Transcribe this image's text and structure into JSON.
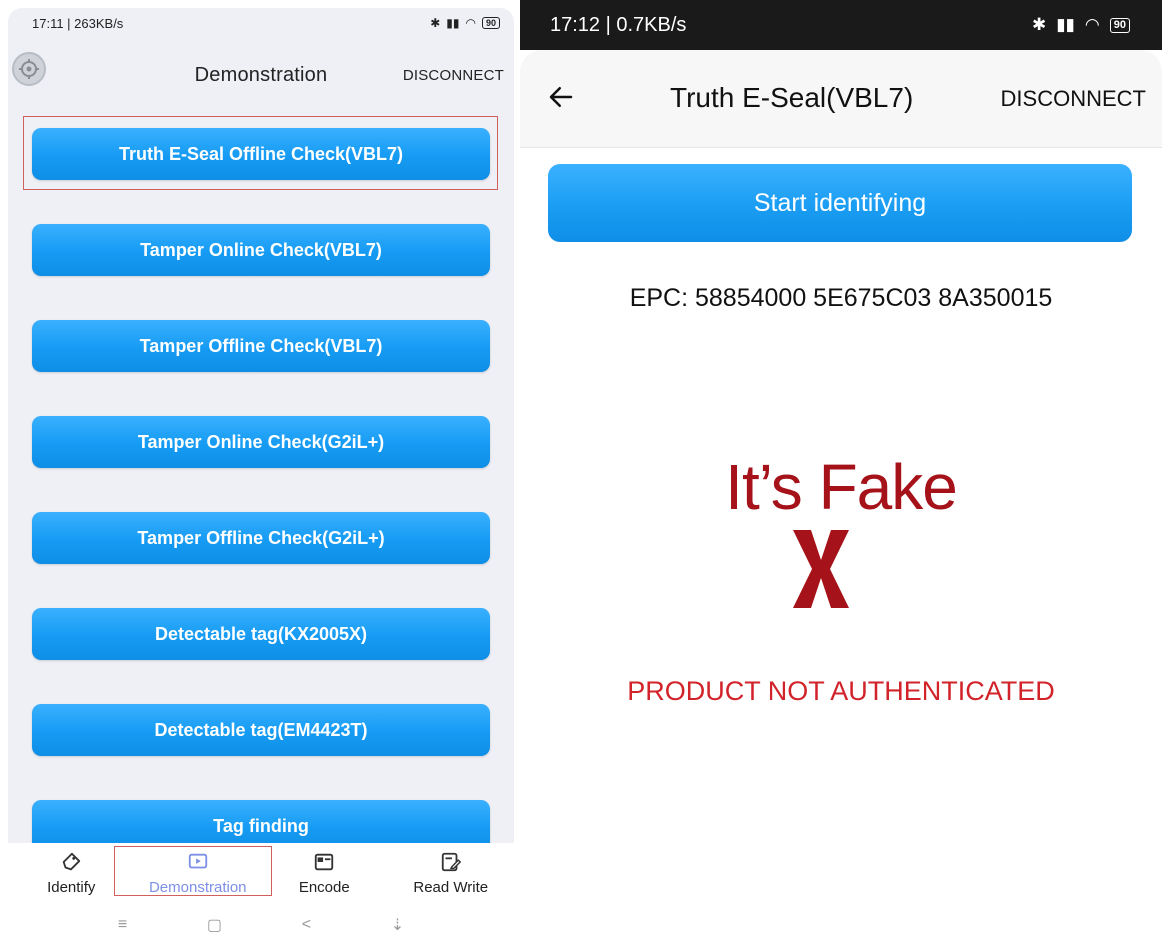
{
  "left": {
    "status": {
      "time": "17:11 | 263KB/s",
      "battery": "90"
    },
    "appbar": {
      "title": "Demonstration",
      "disconnect": "DISCONNECT"
    },
    "buttons": [
      "Truth E-Seal Offline Check(VBL7)",
      "Tamper Online Check(VBL7)",
      "Tamper Offline Check(VBL7)",
      "Tamper Online Check(G2iL+)",
      "Tamper Offline Check(G2iL+)",
      "Detectable tag(KX2005X)",
      "Detectable tag(EM4423T)",
      "Tag finding"
    ],
    "nav": {
      "identify": "Identify",
      "demonstration": "Demonstration",
      "encode": "Encode",
      "read_write": "Read Write",
      "active": "Demonstration"
    },
    "sysnav": {
      "menu": "≡",
      "home": "▢",
      "back": "<",
      "assist": "⇣"
    }
  },
  "right": {
    "status": {
      "time": "17:12 | 0.7KB/s",
      "battery": "90"
    },
    "appbar": {
      "title": "Truth E-Seal(VBL7)",
      "disconnect": "DISCONNECT"
    },
    "start_button": "Start identifying",
    "epc": "EPC: 58854000 5E675C03 8A350015",
    "result": {
      "headline": "It’s Fake",
      "status": "PRODUCT NOT AUTHENTICATED"
    }
  },
  "colors": {
    "button_blue": "#159bf3",
    "fake_red": "#a61219",
    "not_auth_red": "#d2232a",
    "highlight_border": "#d0605c",
    "active_nav": "#7d8fe6"
  }
}
